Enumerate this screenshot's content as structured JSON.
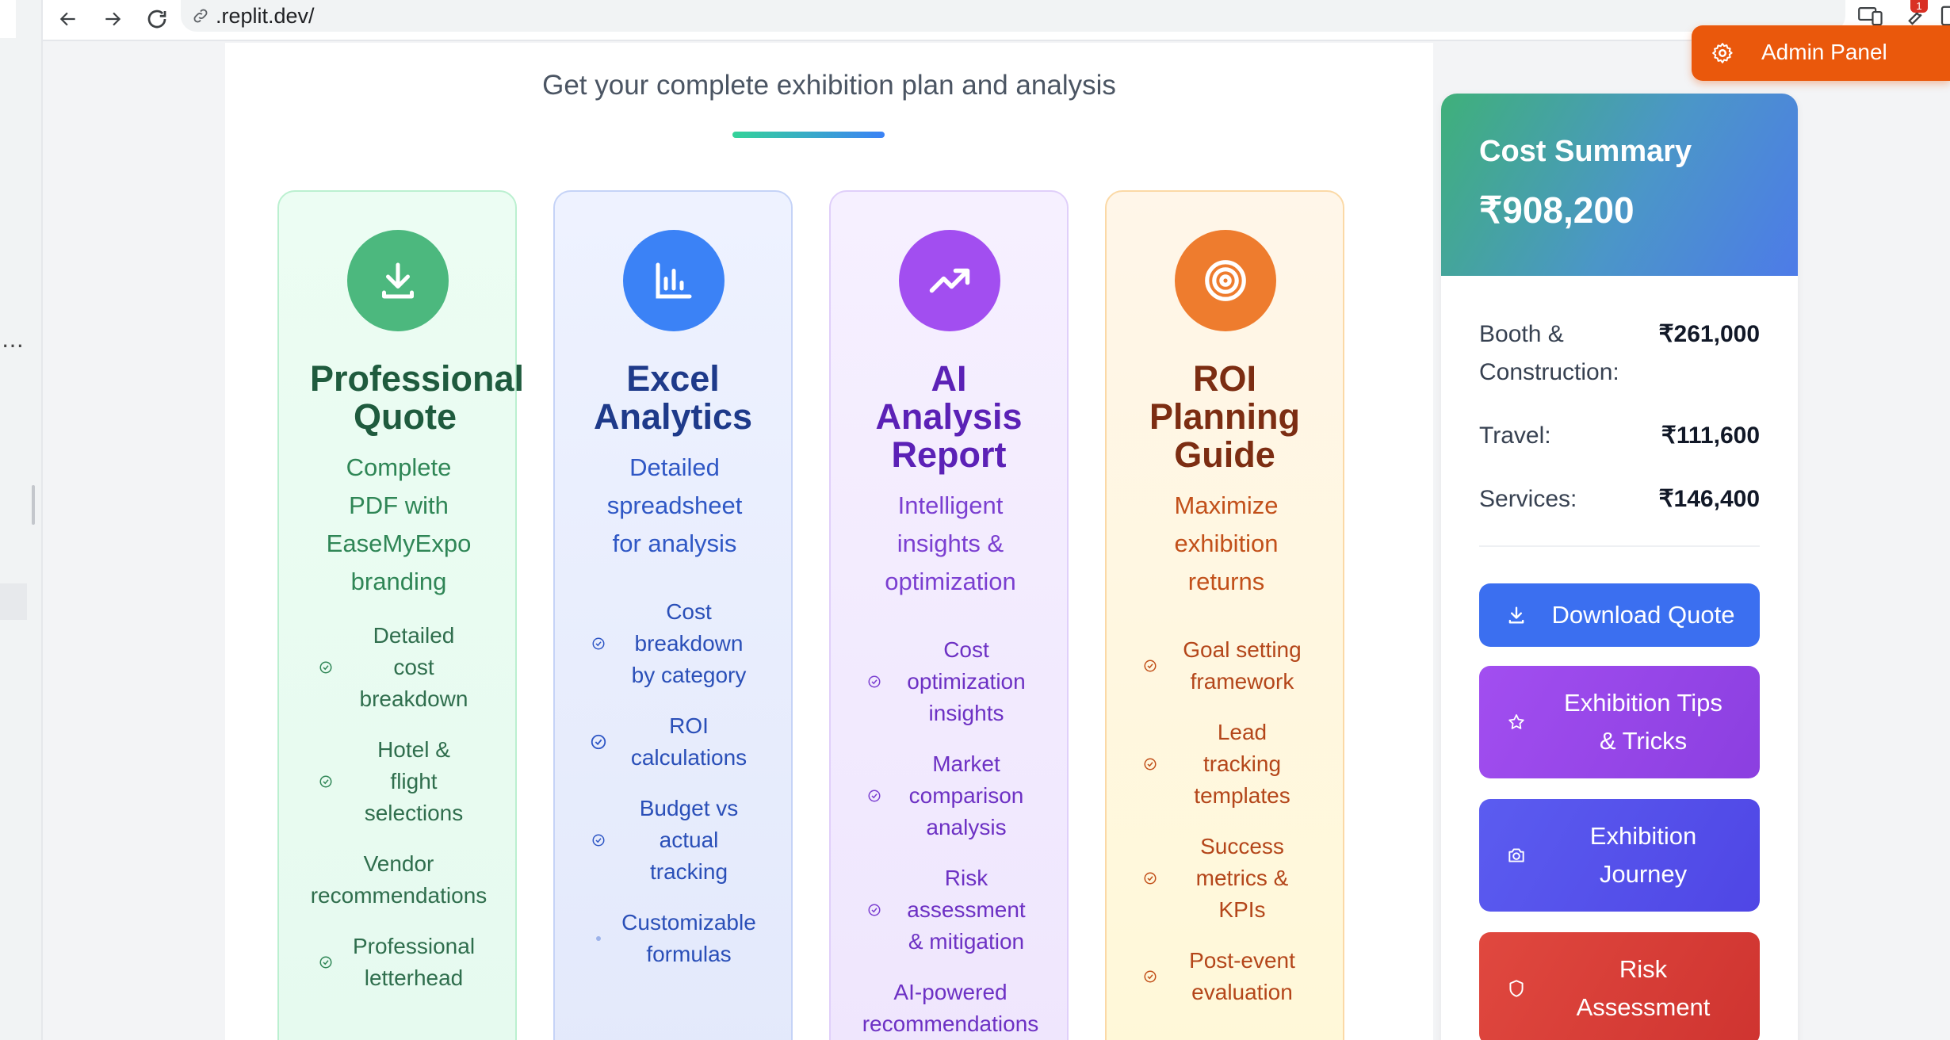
{
  "browser": {
    "url": ".replit.dev/",
    "notification_count": "1"
  },
  "page": {
    "subtitle": "Get your complete exhibition plan and analysis"
  },
  "cards": [
    {
      "title_lines": [
        "Professional",
        "Quote"
      ],
      "desc_lines": [
        "Complete",
        "PDF with",
        "EaseMyExpo",
        "branding"
      ],
      "features": [
        {
          "lines": [
            "Detailed",
            "cost",
            "breakdown"
          ]
        },
        {
          "lines": [
            "Hotel &",
            "flight",
            "selections"
          ]
        },
        {
          "lines": [
            "Vendor",
            "recommendations"
          ]
        },
        {
          "lines": [
            "Professional",
            "letterhead"
          ]
        }
      ],
      "icon": "download-icon",
      "accent": "#4cb87e",
      "title_color": "#1f5b3e",
      "text_color": "#2f8656"
    },
    {
      "title_lines": [
        "Excel",
        "Analytics"
      ],
      "desc_lines": [
        "Detailed",
        "spreadsheet",
        "for analysis"
      ],
      "features": [
        {
          "lines": [
            "Cost",
            "breakdown",
            "by category"
          ]
        },
        {
          "lines": [
            "ROI",
            "calculations"
          ]
        },
        {
          "lines": [
            "Budget vs",
            "actual",
            "tracking"
          ]
        },
        {
          "lines": [
            "Customizable",
            "formulas"
          ]
        }
      ],
      "icon": "bar-chart-icon",
      "accent": "#3b82f6",
      "title_color": "#1e3a8a",
      "text_color": "#2f57c5"
    },
    {
      "title_lines": [
        "AI",
        "Analysis",
        "Report"
      ],
      "desc_lines": [
        "Intelligent",
        "insights &",
        "optimization"
      ],
      "features": [
        {
          "lines": [
            "Cost",
            "optimization",
            "insights"
          ]
        },
        {
          "lines": [
            "Market",
            "comparison",
            "analysis"
          ]
        },
        {
          "lines": [
            "Risk",
            "assessment",
            "& mitigation"
          ]
        },
        {
          "lines": [
            "AI-powered",
            "recommendations"
          ]
        }
      ],
      "icon": "trending-up-icon",
      "accent": "#a24ef0",
      "title_color": "#5b21b6",
      "text_color": "#7b3fd1"
    },
    {
      "title_lines": [
        "ROI",
        "Planning",
        "Guide"
      ],
      "desc_lines": [
        "Maximize",
        "exhibition",
        "returns"
      ],
      "features": [
        {
          "lines": [
            "Goal setting",
            "framework"
          ]
        },
        {
          "lines": [
            "Lead",
            "tracking",
            "templates"
          ]
        },
        {
          "lines": [
            "Success",
            "metrics &",
            "KPIs"
          ]
        },
        {
          "lines": [
            "Post-event",
            "evaluation"
          ]
        }
      ],
      "icon": "target-icon",
      "accent": "#ee7c2e",
      "title_color": "#7c2d12",
      "text_color": "#c2501a"
    }
  ],
  "summary": {
    "title": "Cost Summary",
    "total": "₹908,200",
    "rows": [
      {
        "label_lines": [
          "Booth &",
          "Construction:"
        ],
        "value": "₹261,000"
      },
      {
        "label_lines": [
          "Travel:"
        ],
        "value": "₹111,600"
      },
      {
        "label_lines": [
          "Services:"
        ],
        "value": "₹146,400"
      }
    ]
  },
  "actions": [
    {
      "label_lines": [
        "Download Quote"
      ],
      "icon": "download-icon",
      "color": "#3b6ff0"
    },
    {
      "label_lines": [
        "Exhibition Tips",
        "& Tricks"
      ],
      "icon": "star-icon",
      "color": "#9b4be8"
    },
    {
      "label_lines": [
        "Exhibition",
        "Journey"
      ],
      "icon": "camera-icon",
      "color": "#5b56e6"
    },
    {
      "label_lines": [
        "Risk",
        "Assessment"
      ],
      "icon": "shield-icon",
      "color": "#dc3b37"
    }
  ],
  "admin": {
    "label": "Admin Panel"
  }
}
